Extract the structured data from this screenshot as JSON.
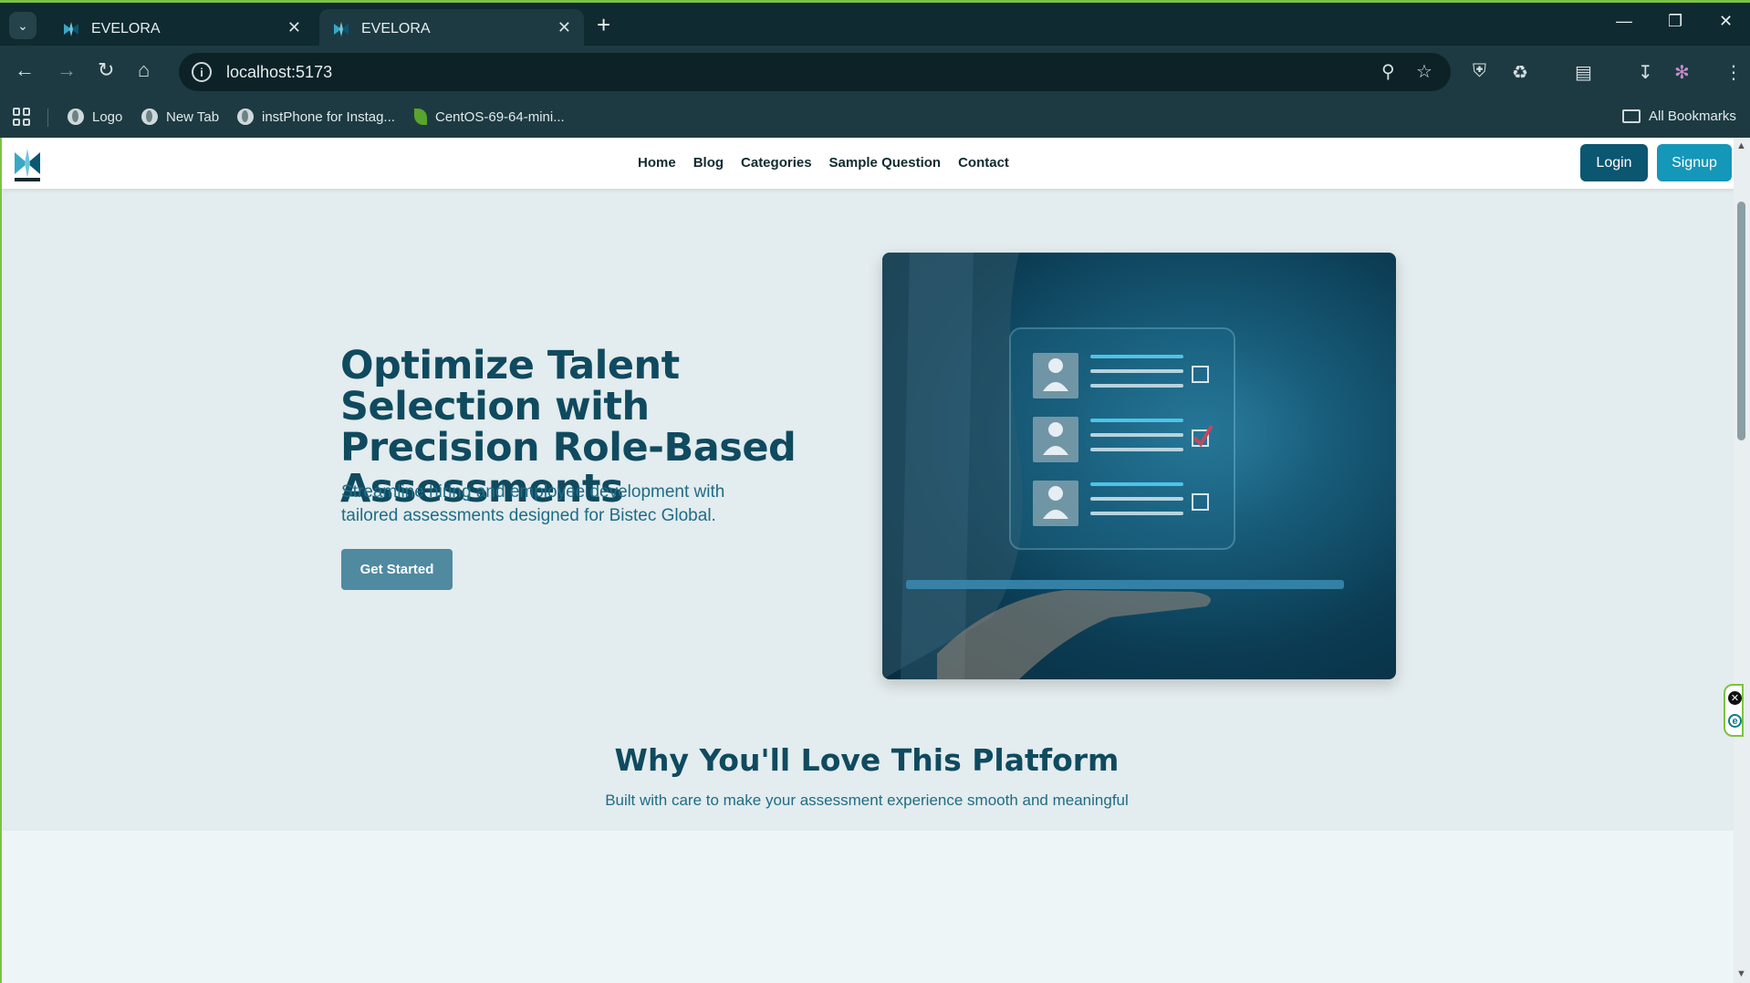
{
  "browser": {
    "tabs": [
      {
        "title": "EVELORA",
        "active": false
      },
      {
        "title": "EVELORA",
        "active": true
      }
    ],
    "url": "localhost:5173",
    "bookmarks": [
      {
        "label": "Logo",
        "icon": "globe-icon"
      },
      {
        "label": "New Tab",
        "icon": "globe-icon"
      },
      {
        "label": "instPhone for Instag...",
        "icon": "globe-icon"
      },
      {
        "label": "CentOS-69-64-mini...",
        "icon": "leaf-icon"
      }
    ],
    "all_bookmarks": "All Bookmarks",
    "accent": "#7cc243"
  },
  "site": {
    "nav": [
      "Home",
      "Blog",
      "Categories",
      "Sample Question",
      "Contact"
    ],
    "login": "Login",
    "signup": "Signup",
    "logo_text": "EVELORA"
  },
  "hero": {
    "title": "Optimize Talent Selection with Precision Role-Based Assessments",
    "subtitle": "Streamline hiring and employee development with tailored assessments designed for Bistec Global.",
    "cta": "Get Started",
    "image": "hand-holding-tablet-checklist-image"
  },
  "features": {
    "title": "Why You'll Love This Platform",
    "subtitle": "Built with care to make your assessment experience smooth and meaningful"
  },
  "colors": {
    "primary": "#0b5671",
    "secondary": "#1497b8",
    "heading": "#0f4a5f",
    "text": "#1f6c86",
    "cta": "#4f8aa0"
  }
}
